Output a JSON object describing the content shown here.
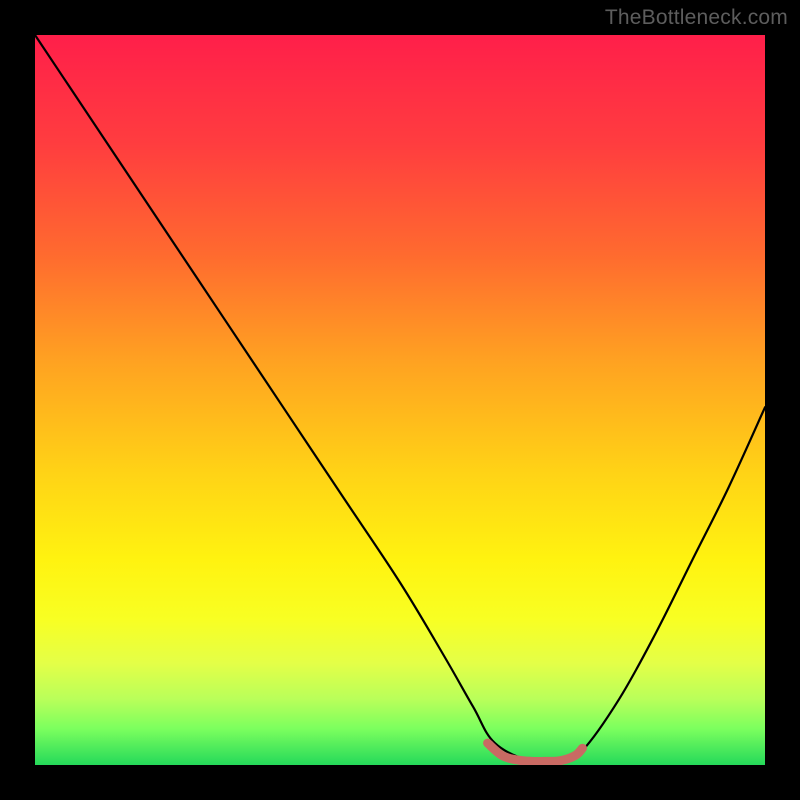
{
  "watermark": "TheBottleneck.com",
  "gradient_stops": [
    {
      "offset": 0.0,
      "color": "#ff1f4a"
    },
    {
      "offset": 0.15,
      "color": "#ff3d3f"
    },
    {
      "offset": 0.3,
      "color": "#ff6a2f"
    },
    {
      "offset": 0.45,
      "color": "#ffa321"
    },
    {
      "offset": 0.6,
      "color": "#ffd316"
    },
    {
      "offset": 0.72,
      "color": "#fff310"
    },
    {
      "offset": 0.8,
      "color": "#f8ff23"
    },
    {
      "offset": 0.86,
      "color": "#e4ff47"
    },
    {
      "offset": 0.91,
      "color": "#b9ff5a"
    },
    {
      "offset": 0.95,
      "color": "#7cff5e"
    },
    {
      "offset": 1.0,
      "color": "#25d95a"
    }
  ],
  "chart_data": {
    "type": "line",
    "title": "",
    "xlabel": "",
    "ylabel": "",
    "xlim": [
      0,
      100
    ],
    "ylim": [
      0,
      100
    ],
    "series": [
      {
        "name": "curve",
        "x": [
          0,
          4,
          10,
          18,
          26,
          34,
          42,
          50,
          56,
          60,
          63,
          68,
          72,
          75,
          80,
          85,
          90,
          95,
          100
        ],
        "values": [
          100,
          94,
          85,
          73,
          61,
          49,
          37,
          25,
          15,
          8,
          3,
          0.5,
          0.5,
          2,
          9,
          18,
          28,
          38,
          49
        ]
      }
    ],
    "highlight": {
      "name": "min-band",
      "color": "#c96a63",
      "x": [
        62,
        64,
        66,
        68,
        70,
        72,
        74,
        75
      ],
      "values": [
        3.0,
        1.3,
        0.7,
        0.5,
        0.5,
        0.6,
        1.3,
        2.3
      ]
    }
  }
}
